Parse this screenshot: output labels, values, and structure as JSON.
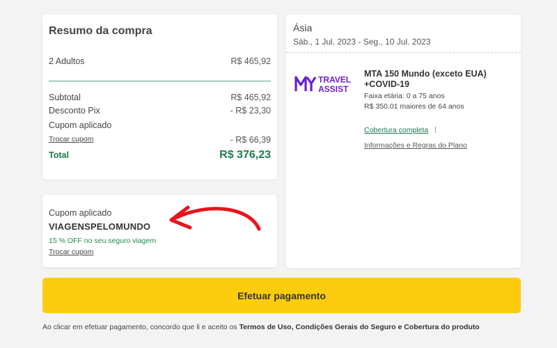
{
  "summary": {
    "title": "Resumo da compra",
    "travelers_label": "2 Adultos",
    "travelers_value": "R$ 465,92",
    "subtotal_label": "Subtotal",
    "subtotal_value": "R$ 465,92",
    "pix_label": "Desconto Pix",
    "pix_value": "- R$ 23,30",
    "coupon_label": "Cupom aplicado",
    "change_coupon": "Trocar cupom",
    "coupon_value": "- R$ 66,39",
    "total_label": "Total",
    "total_value": "R$ 376,23"
  },
  "coupon_box": {
    "label": "Cupom aplicado",
    "code": "VIAGENSPELOMUNDO",
    "discount_text": "15 % OFF no seu seguro viagem",
    "change": "Trocar cupom"
  },
  "plan": {
    "region": "Ásia",
    "dates": "Sáb., 1 Jul. 2023 - Seg., 10 Jul. 2023",
    "logo_line1": "TRAVEL",
    "logo_line2": "ASSIST",
    "name": "MTA 150 Mundo (exceto EUA) +COVID-19",
    "age_range": "Faixa etária: 0 a 75 anos",
    "over_64": "R$ 350,01 maiores de 64 anos",
    "coverage_link": "Cobertura completa",
    "separator": "|",
    "info_link": "Informações e Regras do Plano"
  },
  "pay_button": "Efetuar pagamento",
  "terms": {
    "prefix": "Ao clicar em efetuar pagamento, concordo que li e aceito os ",
    "links": "Termos de Uso, Condições Gerais do Seguro e Cobertura do produto"
  },
  "colors": {
    "accent_green": "#1f7a4a",
    "button_yellow": "#fecc0f",
    "arrow_red": "#e8141b",
    "logo_purple": "#6a1fd0"
  }
}
